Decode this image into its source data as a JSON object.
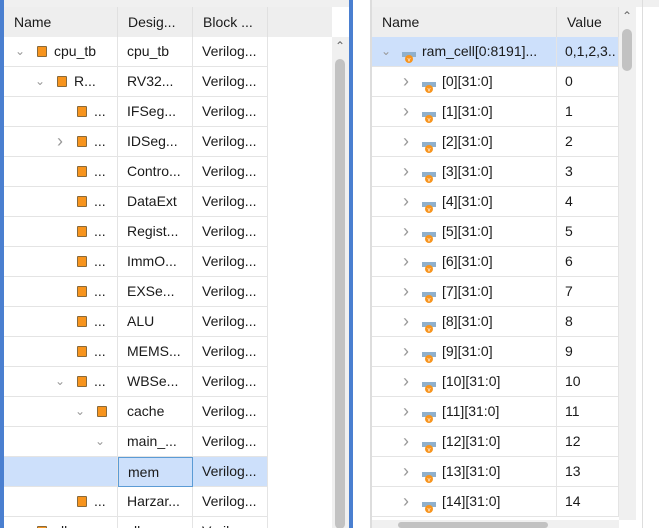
{
  "left": {
    "columns": [
      "Name",
      "Desig...",
      "Block ..."
    ],
    "rows": [
      {
        "level": 0,
        "chev": "down",
        "icon": "chip",
        "name": "cpu_tb",
        "design": "cpu_tb",
        "block": "Verilog..."
      },
      {
        "level": 1,
        "chev": "down",
        "icon": "chip",
        "name": "R...",
        "design": "RV32...",
        "block": "Verilog..."
      },
      {
        "level": 2,
        "chev": "",
        "icon": "chip",
        "name": "...",
        "design": "IFSeg...",
        "block": "Verilog..."
      },
      {
        "level": 2,
        "chev": "right",
        "icon": "chip",
        "name": "...",
        "design": "IDSeg...",
        "block": "Verilog..."
      },
      {
        "level": 2,
        "chev": "",
        "icon": "chip",
        "name": "...",
        "design": "Contro...",
        "block": "Verilog..."
      },
      {
        "level": 2,
        "chev": "",
        "icon": "chip",
        "name": "...",
        "design": "DataExt",
        "block": "Verilog..."
      },
      {
        "level": 2,
        "chev": "",
        "icon": "chip",
        "name": "...",
        "design": "Regist...",
        "block": "Verilog..."
      },
      {
        "level": 2,
        "chev": "",
        "icon": "chip",
        "name": "...",
        "design": "ImmO...",
        "block": "Verilog..."
      },
      {
        "level": 2,
        "chev": "",
        "icon": "chip",
        "name": "...",
        "design": "EXSe...",
        "block": "Verilog..."
      },
      {
        "level": 2,
        "chev": "",
        "icon": "chip",
        "name": "...",
        "design": "ALU",
        "block": "Verilog..."
      },
      {
        "level": 2,
        "chev": "",
        "icon": "chip",
        "name": "...",
        "design": "MEMS...",
        "block": "Verilog..."
      },
      {
        "level": 2,
        "chev": "down",
        "icon": "chip",
        "name": "...",
        "design": "WBSe...",
        "block": "Verilog..."
      },
      {
        "level": 3,
        "chev": "down",
        "icon": "chip",
        "name": "",
        "design": "cache",
        "block": "Verilog..."
      },
      {
        "level": 4,
        "chev": "down",
        "icon": "dots",
        "name": "",
        "design": "main_...",
        "block": "Verilog..."
      },
      {
        "level": 5,
        "chev": "",
        "icon": "",
        "name": "",
        "design": "mem",
        "block": "Verilog...",
        "selected": true
      },
      {
        "level": 2,
        "chev": "",
        "icon": "chip",
        "name": "...",
        "design": "Harzar...",
        "block": "Verilog..."
      },
      {
        "level": 0,
        "chev": "",
        "icon": "chip",
        "name": "clk...",
        "design": "clk...",
        "block": "Verilo..."
      }
    ]
  },
  "right": {
    "columns": [
      "Name",
      "Value"
    ],
    "rows": [
      {
        "level": 0,
        "chev": "down",
        "name": "ram_cell[0:8191]...",
        "value": "0,1,2,3..",
        "selected": true
      },
      {
        "level": 1,
        "chev": "right",
        "name": "[0][31:0]",
        "value": "0"
      },
      {
        "level": 1,
        "chev": "right",
        "name": "[1][31:0]",
        "value": "1"
      },
      {
        "level": 1,
        "chev": "right",
        "name": "[2][31:0]",
        "value": "2"
      },
      {
        "level": 1,
        "chev": "right",
        "name": "[3][31:0]",
        "value": "3"
      },
      {
        "level": 1,
        "chev": "right",
        "name": "[4][31:0]",
        "value": "4"
      },
      {
        "level": 1,
        "chev": "right",
        "name": "[5][31:0]",
        "value": "5"
      },
      {
        "level": 1,
        "chev": "right",
        "name": "[6][31:0]",
        "value": "6"
      },
      {
        "level": 1,
        "chev": "right",
        "name": "[7][31:0]",
        "value": "7"
      },
      {
        "level": 1,
        "chev": "right",
        "name": "[8][31:0]",
        "value": "8"
      },
      {
        "level": 1,
        "chev": "right",
        "name": "[9][31:0]",
        "value": "9"
      },
      {
        "level": 1,
        "chev": "right",
        "name": "[10][31:0]",
        "value": "10"
      },
      {
        "level": 1,
        "chev": "right",
        "name": "[11][31:0]",
        "value": "11"
      },
      {
        "level": 1,
        "chev": "right",
        "name": "[12][31:0]",
        "value": "12"
      },
      {
        "level": 1,
        "chev": "right",
        "name": "[13][31:0]",
        "value": "13"
      },
      {
        "level": 1,
        "chev": "right",
        "name": "[14][31:0]",
        "value": "14"
      }
    ]
  }
}
